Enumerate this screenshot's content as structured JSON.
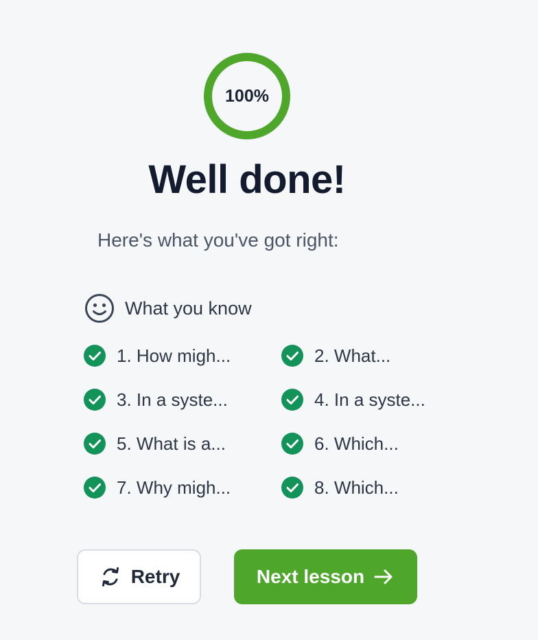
{
  "progress": {
    "value": 100,
    "label": "100%",
    "color": "#4ea72a"
  },
  "result": {
    "title": "Well done!",
    "subtitle": "Here's what you've got right:"
  },
  "section": {
    "icon": "smile-icon",
    "label": "What you know"
  },
  "correct_items": [
    {
      "label": "1. How migh...",
      "icon": "check-circle-icon"
    },
    {
      "label": "2. What...",
      "icon": "check-circle-icon"
    },
    {
      "label": "3. In a syste...",
      "icon": "check-circle-icon"
    },
    {
      "label": "4. In a syste...",
      "icon": "check-circle-icon"
    },
    {
      "label": "5. What is a...",
      "icon": "check-circle-icon"
    },
    {
      "label": "6. Which...",
      "icon": "check-circle-icon"
    },
    {
      "label": "7. Why migh...",
      "icon": "check-circle-icon"
    },
    {
      "label": "8. Which...",
      "icon": "check-circle-icon"
    }
  ],
  "colors": {
    "check": "#13935a",
    "primary_button": "#4ea72a"
  },
  "actions": {
    "retry": {
      "label": "Retry",
      "icon": "refresh-icon"
    },
    "next": {
      "label": "Next lesson",
      "icon": "arrow-right-icon"
    }
  }
}
